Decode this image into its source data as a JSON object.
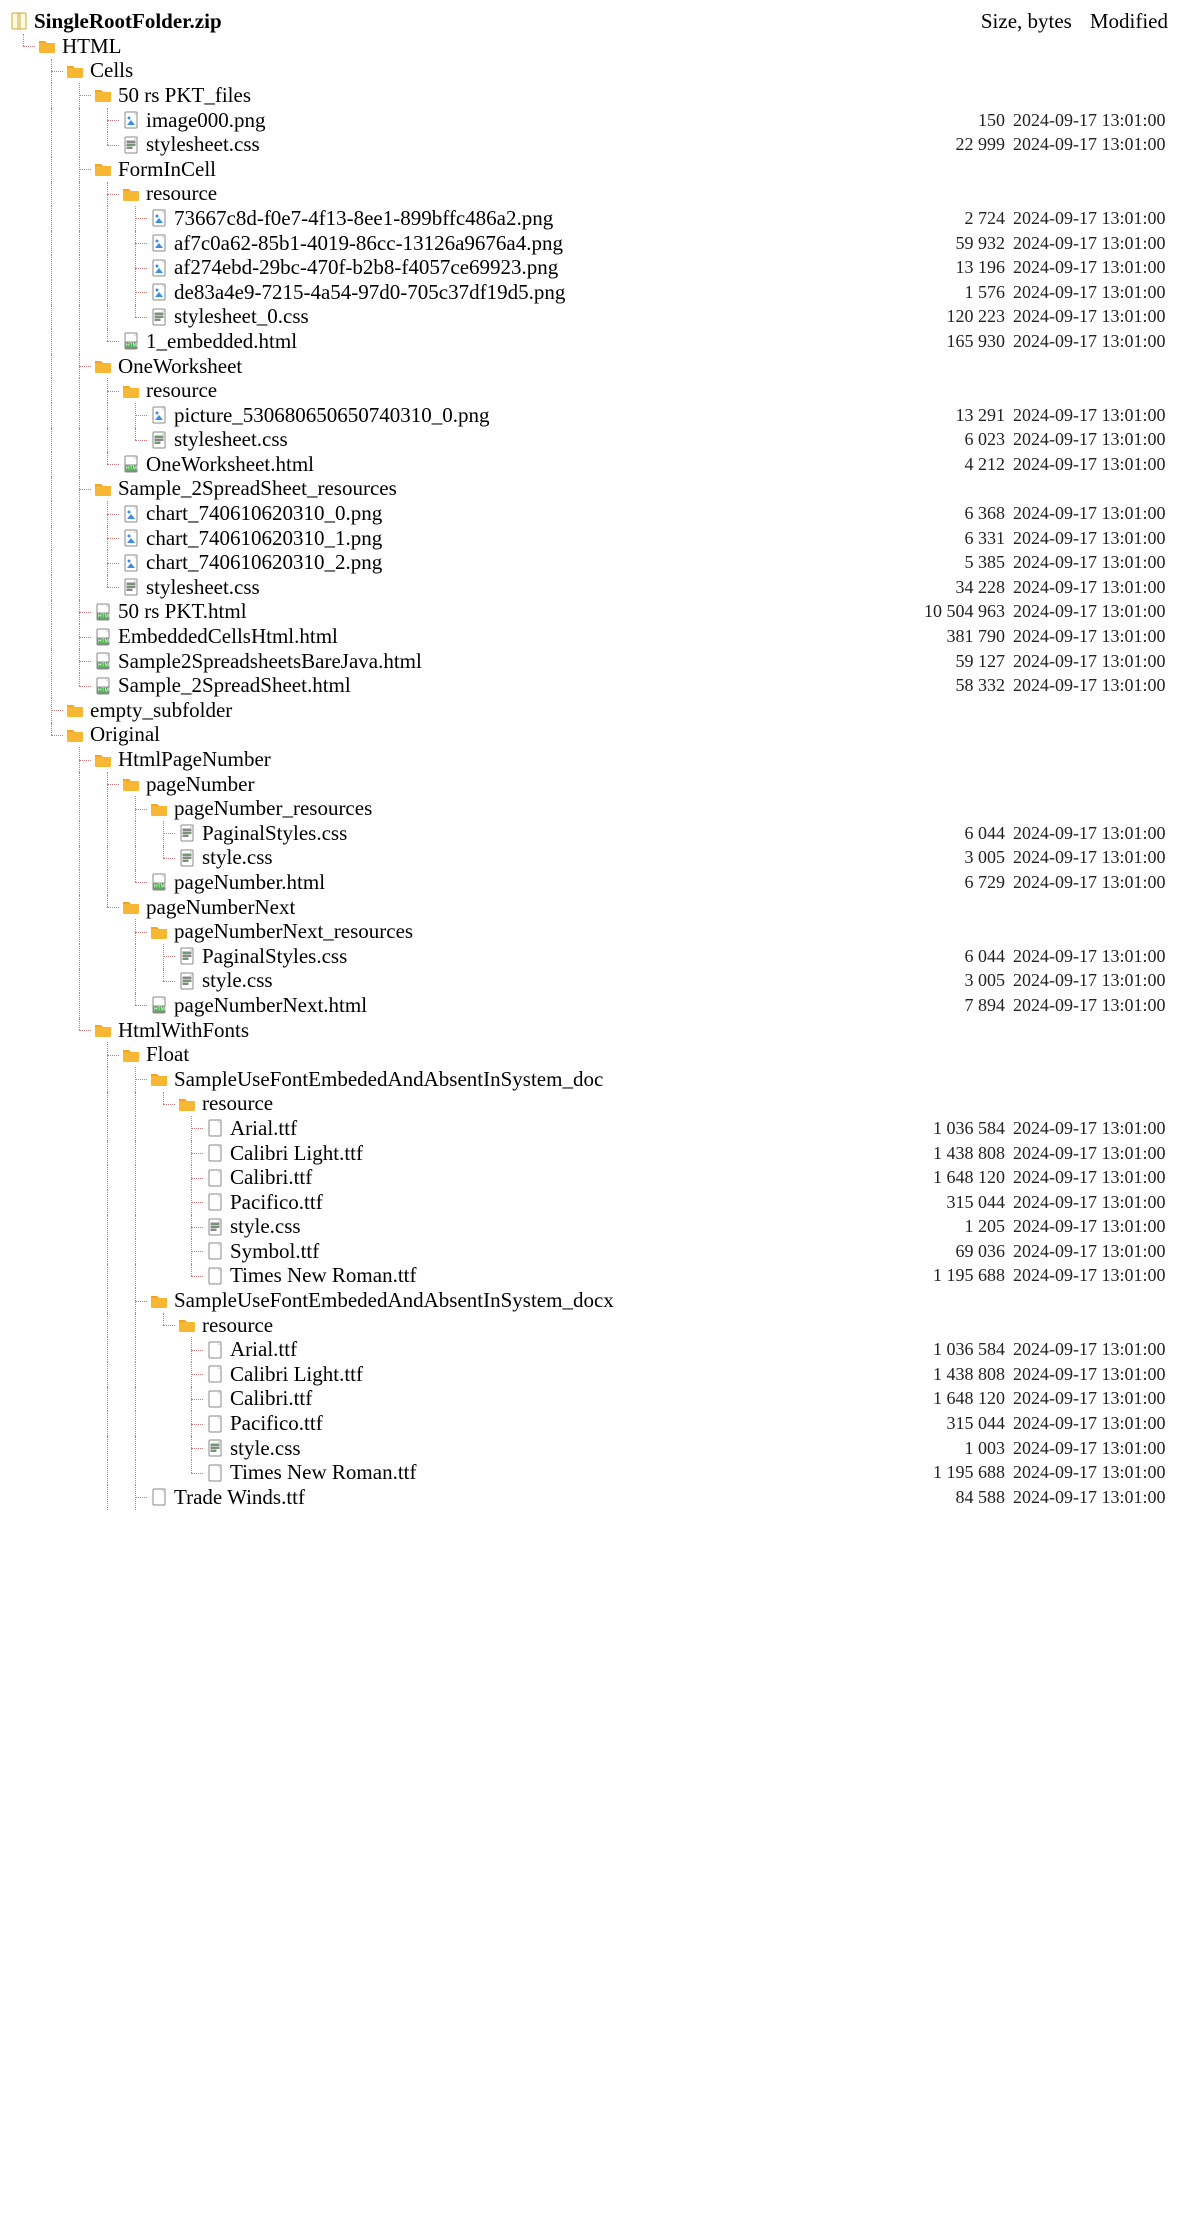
{
  "columns": {
    "size": "Size, bytes",
    "modified": "Modified"
  },
  "tree": [
    {
      "d": 0,
      "last": true,
      "t": "zip",
      "bold": true,
      "n": "SingleRootFolder.zip"
    },
    {
      "d": 1,
      "last": true,
      "t": "folder",
      "n": "HTML"
    },
    {
      "d": 2,
      "last": false,
      "t": "folder",
      "n": "Cells"
    },
    {
      "d": 3,
      "last": false,
      "t": "folder",
      "n": "50 rs PKT_files"
    },
    {
      "d": 4,
      "last": false,
      "t": "img",
      "n": "image000.png",
      "s": "150",
      "m": "2024-09-17 13:01:00"
    },
    {
      "d": 4,
      "last": true,
      "t": "css",
      "n": "stylesheet.css",
      "s": "22 999",
      "m": "2024-09-17 13:01:00"
    },
    {
      "d": 3,
      "last": false,
      "t": "folder",
      "n": "FormInCell"
    },
    {
      "d": 4,
      "last": false,
      "t": "folder",
      "n": "resource"
    },
    {
      "d": 5,
      "last": false,
      "t": "img",
      "n": "73667c8d-f0e7-4f13-8ee1-899bffc486a2.png",
      "s": "2 724",
      "m": "2024-09-17 13:01:00"
    },
    {
      "d": 5,
      "last": false,
      "t": "img",
      "n": "af7c0a62-85b1-4019-86cc-13126a9676a4.png",
      "s": "59 932",
      "m": "2024-09-17 13:01:00"
    },
    {
      "d": 5,
      "last": false,
      "t": "img",
      "n": "af274ebd-29bc-470f-b2b8-f4057ce69923.png",
      "s": "13 196",
      "m": "2024-09-17 13:01:00"
    },
    {
      "d": 5,
      "last": false,
      "t": "img",
      "n": "de83a4e9-7215-4a54-97d0-705c37df19d5.png",
      "s": "1 576",
      "m": "2024-09-17 13:01:00"
    },
    {
      "d": 5,
      "last": true,
      "t": "css",
      "n": "stylesheet_0.css",
      "s": "120 223",
      "m": "2024-09-17 13:01:00"
    },
    {
      "d": 4,
      "last": true,
      "t": "html",
      "n": "1_embedded.html",
      "s": "165 930",
      "m": "2024-09-17 13:01:00"
    },
    {
      "d": 3,
      "last": false,
      "t": "folder",
      "n": "OneWorksheet"
    },
    {
      "d": 4,
      "last": false,
      "t": "folder",
      "n": "resource"
    },
    {
      "d": 5,
      "last": false,
      "t": "img",
      "n": "picture_530680650650740310_0.png",
      "s": "13 291",
      "m": "2024-09-17 13:01:00"
    },
    {
      "d": 5,
      "last": true,
      "t": "css",
      "n": "stylesheet.css",
      "s": "6 023",
      "m": "2024-09-17 13:01:00"
    },
    {
      "d": 4,
      "last": true,
      "t": "html",
      "n": "OneWorksheet.html",
      "s": "4 212",
      "m": "2024-09-17 13:01:00"
    },
    {
      "d": 3,
      "last": false,
      "t": "folder",
      "n": "Sample_2SpreadSheet_resources"
    },
    {
      "d": 4,
      "last": false,
      "t": "img",
      "n": "chart_740610620310_0.png",
      "s": "6 368",
      "m": "2024-09-17 13:01:00"
    },
    {
      "d": 4,
      "last": false,
      "t": "img",
      "n": "chart_740610620310_1.png",
      "s": "6 331",
      "m": "2024-09-17 13:01:00"
    },
    {
      "d": 4,
      "last": false,
      "t": "img",
      "n": "chart_740610620310_2.png",
      "s": "5 385",
      "m": "2024-09-17 13:01:00"
    },
    {
      "d": 4,
      "last": true,
      "t": "css",
      "n": "stylesheet.css",
      "s": "34 228",
      "m": "2024-09-17 13:01:00"
    },
    {
      "d": 3,
      "last": false,
      "t": "html",
      "n": "50 rs PKT.html",
      "s": "10 504 963",
      "m": "2024-09-17 13:01:00"
    },
    {
      "d": 3,
      "last": false,
      "t": "html",
      "n": "EmbeddedCellsHtml.html",
      "s": "381 790",
      "m": "2024-09-17 13:01:00"
    },
    {
      "d": 3,
      "last": false,
      "t": "html",
      "n": "Sample2SpreadsheetsBareJava.html",
      "s": "59 127",
      "m": "2024-09-17 13:01:00"
    },
    {
      "d": 3,
      "last": true,
      "t": "html",
      "n": "Sample_2SpreadSheet.html",
      "s": "58 332",
      "m": "2024-09-17 13:01:00"
    },
    {
      "d": 2,
      "last": false,
      "t": "folder",
      "n": "empty_subfolder"
    },
    {
      "d": 2,
      "last": true,
      "t": "folder",
      "n": "Original"
    },
    {
      "d": 3,
      "last": false,
      "t": "folder",
      "n": "HtmlPageNumber"
    },
    {
      "d": 4,
      "last": false,
      "t": "folder",
      "n": "pageNumber"
    },
    {
      "d": 5,
      "last": false,
      "t": "folder",
      "n": "pageNumber_resources"
    },
    {
      "d": 6,
      "last": false,
      "t": "css",
      "n": "PaginalStyles.css",
      "s": "6 044",
      "m": "2024-09-17 13:01:00"
    },
    {
      "d": 6,
      "last": true,
      "t": "css",
      "n": "style.css",
      "s": "3 005",
      "m": "2024-09-17 13:01:00"
    },
    {
      "d": 5,
      "last": true,
      "t": "html",
      "n": "pageNumber.html",
      "s": "6 729",
      "m": "2024-09-17 13:01:00"
    },
    {
      "d": 4,
      "last": true,
      "t": "folder",
      "n": "pageNumberNext"
    },
    {
      "d": 5,
      "last": false,
      "t": "folder",
      "n": "pageNumberNext_resources"
    },
    {
      "d": 6,
      "last": false,
      "t": "css",
      "n": "PaginalStyles.css",
      "s": "6 044",
      "m": "2024-09-17 13:01:00"
    },
    {
      "d": 6,
      "last": true,
      "t": "css",
      "n": "style.css",
      "s": "3 005",
      "m": "2024-09-17 13:01:00"
    },
    {
      "d": 5,
      "last": true,
      "t": "html",
      "n": "pageNumberNext.html",
      "s": "7 894",
      "m": "2024-09-17 13:01:00"
    },
    {
      "d": 3,
      "last": true,
      "t": "folder",
      "n": "HtmlWithFonts"
    },
    {
      "d": 4,
      "last": false,
      "t": "folder",
      "n": "Float"
    },
    {
      "d": 5,
      "last": false,
      "t": "folder",
      "n": "SampleUseFontEmbededAndAbsentInSystem_doc"
    },
    {
      "d": 6,
      "last": true,
      "t": "folder",
      "n": "resource"
    },
    {
      "d": 7,
      "last": false,
      "t": "file",
      "n": "Arial.ttf",
      "s": "1 036 584",
      "m": "2024-09-17 13:01:00"
    },
    {
      "d": 7,
      "last": false,
      "t": "file",
      "n": "Calibri Light.ttf",
      "s": "1 438 808",
      "m": "2024-09-17 13:01:00"
    },
    {
      "d": 7,
      "last": false,
      "t": "file",
      "n": "Calibri.ttf",
      "s": "1 648 120",
      "m": "2024-09-17 13:01:00"
    },
    {
      "d": 7,
      "last": false,
      "t": "file",
      "n": "Pacifico.ttf",
      "s": "315 044",
      "m": "2024-09-17 13:01:00"
    },
    {
      "d": 7,
      "last": false,
      "t": "css",
      "n": "style.css",
      "s": "1 205",
      "m": "2024-09-17 13:01:00"
    },
    {
      "d": 7,
      "last": false,
      "t": "file",
      "n": "Symbol.ttf",
      "s": "69 036",
      "m": "2024-09-17 13:01:00"
    },
    {
      "d": 7,
      "last": true,
      "t": "file",
      "n": "Times New Roman.ttf",
      "s": "1 195 688",
      "m": "2024-09-17 13:01:00"
    },
    {
      "d": 5,
      "last": false,
      "t": "folder",
      "n": "SampleUseFontEmbededAndAbsentInSystem_docx"
    },
    {
      "d": 6,
      "last": true,
      "t": "folder",
      "n": "resource"
    },
    {
      "d": 7,
      "last": false,
      "t": "file",
      "n": "Arial.ttf",
      "s": "1 036 584",
      "m": "2024-09-17 13:01:00"
    },
    {
      "d": 7,
      "last": false,
      "t": "file",
      "n": "Calibri Light.ttf",
      "s": "1 438 808",
      "m": "2024-09-17 13:01:00"
    },
    {
      "d": 7,
      "last": false,
      "t": "file",
      "n": "Calibri.ttf",
      "s": "1 648 120",
      "m": "2024-09-17 13:01:00"
    },
    {
      "d": 7,
      "last": false,
      "t": "file",
      "n": "Pacifico.ttf",
      "s": "315 044",
      "m": "2024-09-17 13:01:00"
    },
    {
      "d": 7,
      "last": false,
      "t": "css",
      "n": "style.css",
      "s": "1 003",
      "m": "2024-09-17 13:01:00"
    },
    {
      "d": 7,
      "last": true,
      "t": "file",
      "n": "Times New Roman.ttf",
      "s": "1 195 688",
      "m": "2024-09-17 13:01:00"
    },
    {
      "d": 5,
      "last": false,
      "t": "file",
      "n": "Trade Winds.ttf",
      "s": "84 588",
      "m": "2024-09-17 13:01:00"
    }
  ]
}
